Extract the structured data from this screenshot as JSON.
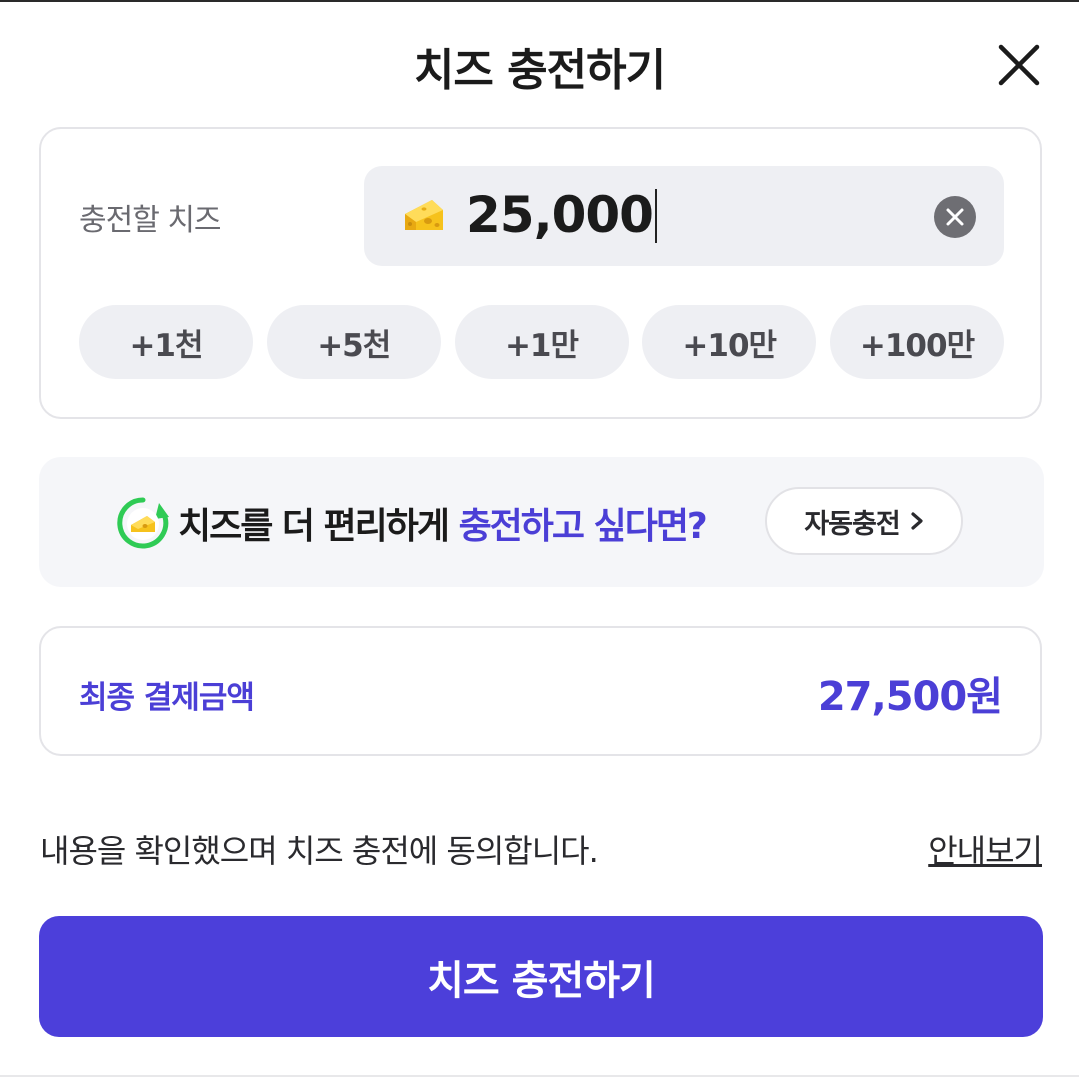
{
  "header": {
    "title": "치즈 충전하기",
    "close_icon": "close-icon"
  },
  "charge": {
    "label": "충전할 치즈",
    "amount": "25,000",
    "currency_icon": "cheese-icon",
    "clear_icon": "clear-icon",
    "quick_add": [
      "+1천",
      "+5천",
      "+1만",
      "+10만",
      "+100만"
    ]
  },
  "promo": {
    "icon": "auto-recharge-cheese-icon",
    "text_plain": "치즈를 더 편리하게 ",
    "text_accent": "충전하고 싶다면?",
    "button_label": "자동충전",
    "button_icon": "chevron-right-icon"
  },
  "payment": {
    "label": "최종 결제금액",
    "amount": "27,500원"
  },
  "consent": {
    "text": "내용을 확인했으며 치즈 충전에 동의합니다.",
    "link_label": "안내보기"
  },
  "submit": {
    "label": "치즈 충전하기"
  },
  "colors": {
    "accent": "#4b3fd6",
    "button": "#4c3fda",
    "field_bg": "#eeeff3",
    "promo_bg": "#f5f6f9",
    "cheese": "#f6c21c",
    "recharge_green": "#2fcb55"
  }
}
